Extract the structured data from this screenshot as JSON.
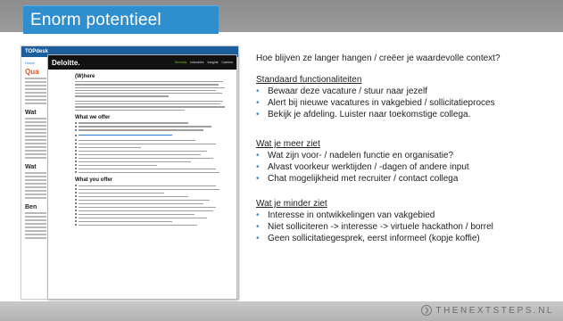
{
  "slide": {
    "title": "Enorm potentieel",
    "brand": "THENEXTSTEPS.NL",
    "brand_icon": "circle-arrow-icon",
    "question": "Hoe blijven ze langer hangen / creëer je waardevolle context?",
    "sections": [
      {
        "heading": "Standaard functionaliteiten",
        "items": [
          "Bewaar deze vacature / stuur naar jezelf",
          "Alert bij nieuwe vacatures in vakgebied / sollicitatieproces",
          "Bekijk je afdeling. Luister naar toekomstige collega."
        ]
      },
      {
        "heading": "Wat je meer ziet",
        "items": [
          "Wat zijn voor- / nadelen functie en organisatie?",
          "Alvast voorkeur werktijden / -dagen of andere input",
          "Chat mogelijkheid met recruiter / contact collega"
        ]
      },
      {
        "heading": "Wat je minder ziet",
        "items": [
          "Interesse in ontwikkelingen van vakgebied",
          "Niet solliciteren -> interesse -> virtuele hackathon / borrel",
          "Geen sollicitatiegesprek, eerst informeel (kopje koffie)"
        ]
      }
    ]
  },
  "screenshot_back": {
    "logo": "TOPdesk",
    "crumb": "Home",
    "title": "Qua",
    "headings": [
      "Wat",
      "Wat",
      "Ben"
    ]
  },
  "screenshot_front": {
    "logo": "Deloitte.",
    "nav": [
      "Services",
      "Industries",
      "Insights",
      "Careers"
    ],
    "active_nav": "Careers",
    "heading_where": "(W)here",
    "heading_offer1": "What we offer",
    "heading_offer2": "What you offer"
  },
  "colors": {
    "title_bg": "#2f8fce",
    "bullet": "#3a8fd0",
    "deloitte_green": "#86bc25"
  }
}
